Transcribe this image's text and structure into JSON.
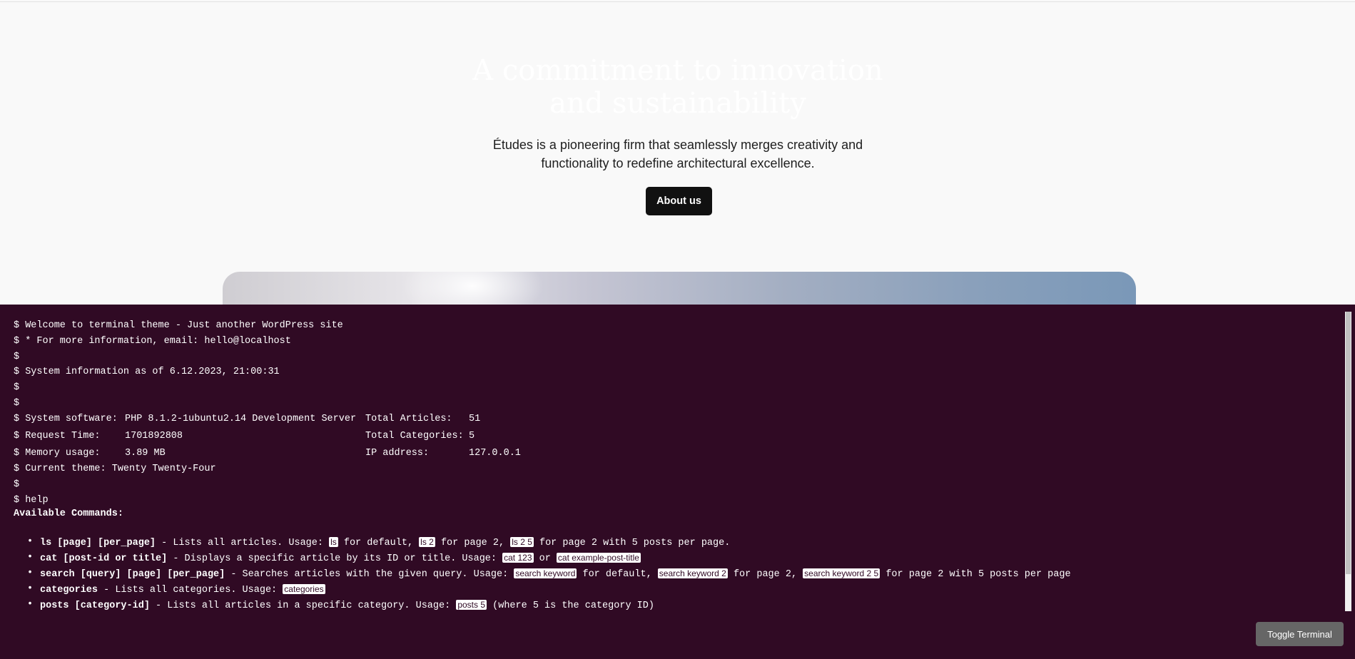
{
  "hero": {
    "title_line1": "A commitment to innovation",
    "title_line2": "and sustainability",
    "description_line1": "Études is a pioneering firm that seamlessly merges creativity and",
    "description_line2": "functionality to redefine architectural excellence.",
    "button_label": "About us"
  },
  "terminal": {
    "lines": {
      "welcome": "$ Welcome to terminal theme - Just another WordPress site",
      "info": "$ * For more information, email: hello@localhost",
      "blank1": "$",
      "sysinfo": "$ System information as of 6.12.2023, 21:00:31",
      "blank2": "$",
      "blank3": "$",
      "prompt_software": "$ System software:",
      "prompt_request": "$ Request Time:",
      "prompt_memory": "$ Memory usage:",
      "theme": "$ Current theme: Twenty Twenty-Four",
      "blank4": "$",
      "help": "$ help"
    },
    "stats": {
      "software_value": "PHP 8.1.2-1ubuntu2.14 Development Server",
      "request_value": "1701892808",
      "memory_value": "3.89 MB",
      "articles_label": "Total Articles:",
      "articles_value": "51",
      "categories_label": "Total Categories:",
      "categories_value": "5",
      "ip_label": "IP address:",
      "ip_value": "127.0.0.1"
    },
    "available_commands_title": "Available Commands:",
    "commands": [
      {
        "name": "ls [page] [per_page]",
        "t1": " - Lists all articles. Usage: ",
        "c1": "ls",
        "t2": " for default, ",
        "c2": "ls 2",
        "t3": " for page 2, ",
        "c3": "ls 2 5",
        "t4": " for page 2 with 5 posts per page."
      },
      {
        "name": "cat [post-id or title]",
        "t1": " - Displays a specific article by its ID or title. Usage: ",
        "c1": "cat 123",
        "t2": " or ",
        "c2": "cat example-post-title"
      },
      {
        "name": "search [query] [page] [per_page]",
        "t1": " - Searches articles with the given query. Usage: ",
        "c1": "search keyword",
        "t2": " for default, ",
        "c2": "search keyword 2",
        "t3": " for page 2, ",
        "c3": "search keyword 2 5",
        "t4": " for page 2 with 5 posts per page"
      },
      {
        "name": "categories",
        "t1": " - Lists all categories. Usage: ",
        "c1": "categories"
      },
      {
        "name": "posts [category-id]",
        "t1": " - Lists all articles in a specific category. Usage: ",
        "c1": "posts 5",
        "t2": " (where 5 is the category ID)"
      }
    ],
    "toggle_label": "Toggle Terminal"
  }
}
